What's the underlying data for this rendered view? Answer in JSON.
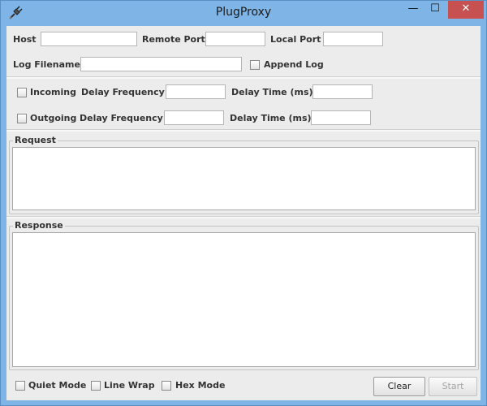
{
  "window": {
    "title": "PlugProxy",
    "minimize": "—",
    "maximize": "☐",
    "close": "✕"
  },
  "connection": {
    "host_label": "Host",
    "host_value": "",
    "remote_port_label": "Remote Port",
    "remote_port_value": "",
    "local_port_label": "Local Port",
    "local_port_value": "",
    "log_filename_label": "Log Filename",
    "log_filename_value": "",
    "append_log_label": "Append Log",
    "append_log_checked": false
  },
  "delays": {
    "incoming_label": "Incoming",
    "incoming_checked": false,
    "incoming_freq_label": "Delay Frequency",
    "incoming_freq_value": "",
    "incoming_time_label": "Delay Time (ms)",
    "incoming_time_value": "",
    "outgoing_label": "Outgoing",
    "outgoing_checked": false,
    "outgoing_freq_label": "Delay Frequency",
    "outgoing_freq_value": "",
    "outgoing_time_label": "Delay Time (ms)",
    "outgoing_time_value": ""
  },
  "request": {
    "label": "Request",
    "content": ""
  },
  "response": {
    "label": "Response",
    "content": ""
  },
  "options": {
    "quiet_mode_label": "Quiet Mode",
    "quiet_mode_checked": false,
    "line_wrap_label": "Line Wrap",
    "line_wrap_checked": false,
    "hex_mode_label": "Hex Mode",
    "hex_mode_checked": false
  },
  "buttons": {
    "clear_label": "Clear",
    "start_label": "Start",
    "start_enabled": false
  },
  "icons": {
    "app_icon": "plug-icon"
  }
}
